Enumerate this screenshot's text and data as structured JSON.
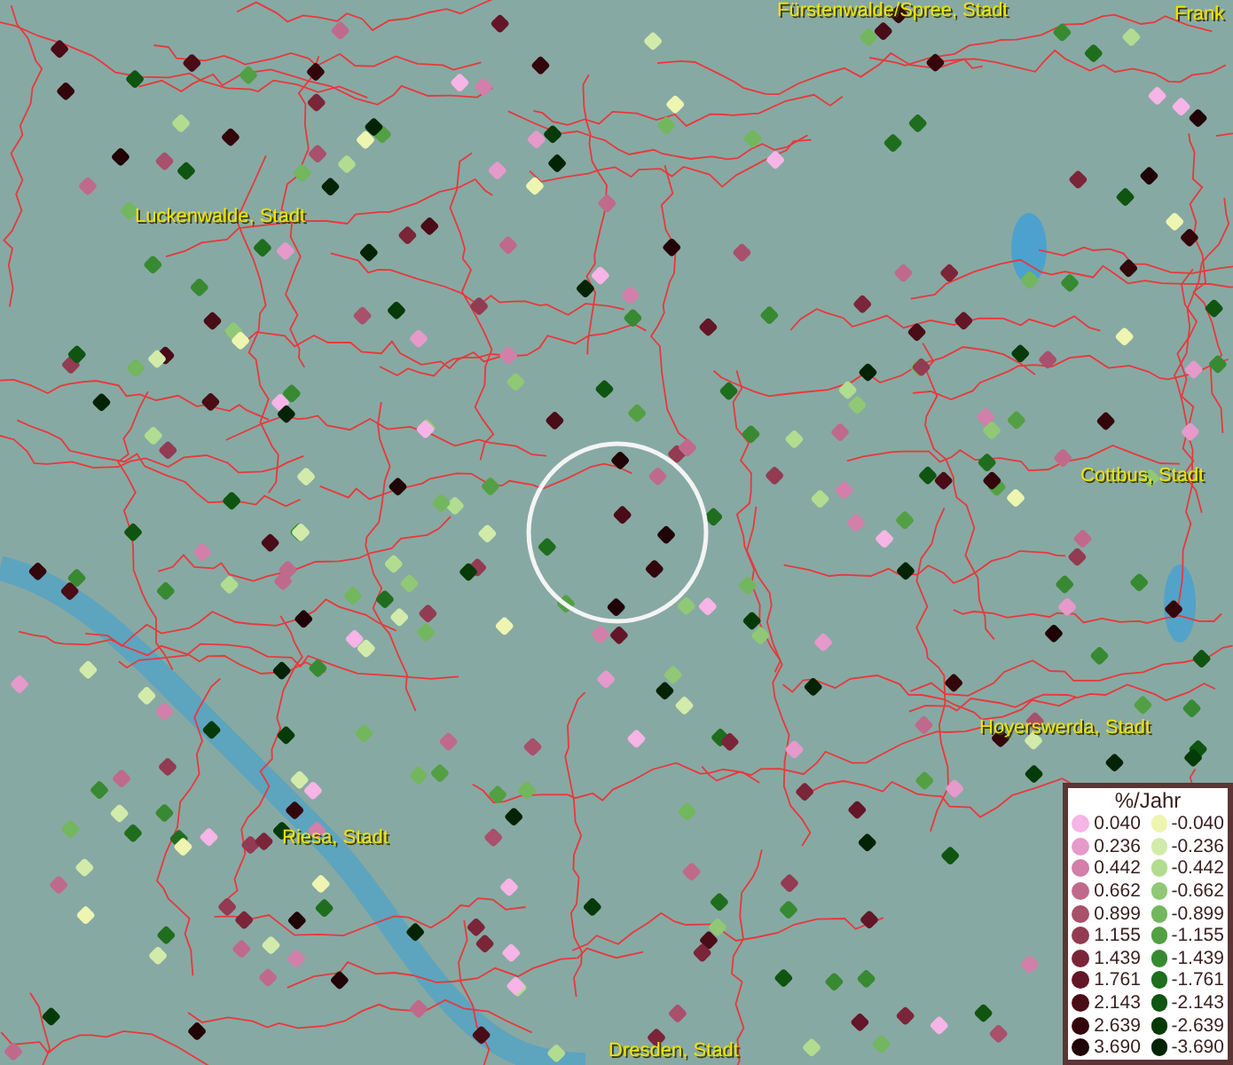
{
  "map": {
    "place_labels": [
      {
        "text": "Fürstenwalde/Spree, Stadt"
      },
      {
        "text": "Frank"
      },
      {
        "text": "Luckenwalde, Stadt"
      },
      {
        "text": "Cottbus, Stadt"
      },
      {
        "text": "Hoyerswerda, Stadt"
      },
      {
        "text": "Riesa, Stadt"
      },
      {
        "text": "Dresden, Stadt"
      }
    ]
  },
  "legend": {
    "title": "%/Jahr",
    "rows": [
      {
        "positive": {
          "label": "0.040",
          "color": "#f7b4e6"
        },
        "negative": {
          "label": "-0.040",
          "color": "#eef5b0"
        }
      },
      {
        "positive": {
          "label": "0.236",
          "color": "#e59acb"
        },
        "negative": {
          "label": "-0.236",
          "color": "#d2ebaa"
        }
      },
      {
        "positive": {
          "label": "0.442",
          "color": "#d27fa9"
        },
        "negative": {
          "label": "-0.442",
          "color": "#b2dc90"
        }
      },
      {
        "positive": {
          "label": "0.662",
          "color": "#c06a8b"
        },
        "negative": {
          "label": "-0.662",
          "color": "#90c875"
        }
      },
      {
        "positive": {
          "label": "0.899",
          "color": "#a8506c"
        },
        "negative": {
          "label": "-0.899",
          "color": "#72b75e"
        }
      },
      {
        "positive": {
          "label": "1.155",
          "color": "#923b52"
        },
        "negative": {
          "label": "-1.155",
          "color": "#52a043"
        }
      },
      {
        "positive": {
          "label": "1.439",
          "color": "#7b2539"
        },
        "negative": {
          "label": "-1.439",
          "color": "#378a31"
        }
      },
      {
        "positive": {
          "label": "1.761",
          "color": "#631627"
        },
        "negative": {
          "label": "-1.761",
          "color": "#1e6e1e"
        }
      },
      {
        "positive": {
          "label": "2.143",
          "color": "#4a0c17"
        },
        "negative": {
          "label": "-2.143",
          "color": "#0f5511"
        }
      },
      {
        "positive": {
          "label": "2.639",
          "color": "#33060c"
        },
        "negative": {
          "label": "-2.639",
          "color": "#063b09"
        }
      },
      {
        "positive": {
          "label": "3.690",
          "color": "#200306"
        },
        "negative": {
          "label": "-3.690",
          "color": "#022304"
        }
      }
    ]
  }
}
